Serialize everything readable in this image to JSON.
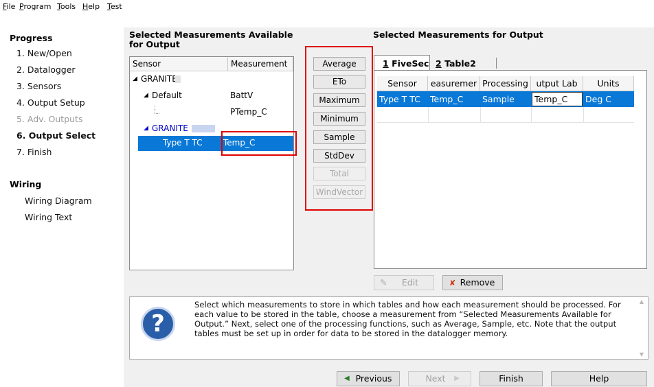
{
  "menu": [
    "File",
    "Program",
    "Tools",
    "Help",
    "Test"
  ],
  "progress": {
    "title": "Progress",
    "steps": [
      "1. New/Open",
      "2. Datalogger",
      "3. Sensors",
      "4. Output Setup",
      "5. Adv. Outputs",
      "6. Output Select",
      "7. Finish"
    ]
  },
  "wiring": {
    "title": "Wiring",
    "items": [
      "Wiring Diagram",
      "Wiring Text"
    ]
  },
  "available": {
    "title": "Selected Measurements Available for Output",
    "columns": [
      "Sensor",
      "Measurement"
    ],
    "rows": [
      {
        "sensor": "GRANITE",
        "measurement": ""
      },
      {
        "sensor": "Default",
        "measurement": "BattV"
      },
      {
        "sensor": "",
        "measurement": "PTemp_C"
      },
      {
        "sensor": "GRANITE",
        "measurement": ""
      },
      {
        "sensor": "Type T TC",
        "measurement": "Temp_C"
      }
    ]
  },
  "functions": [
    "Average",
    "ETo",
    "Maximum",
    "Minimum",
    "Sample",
    "StdDev",
    "Total",
    "WindVector"
  ],
  "output": {
    "title": "Selected Measurements for Output",
    "tabs": [
      {
        "num": "1",
        "name": "FiveSec"
      },
      {
        "num": "2",
        "name": "Table2"
      }
    ],
    "columns": [
      "Sensor",
      "easuremer",
      "Processing",
      "utput Lab",
      "Units"
    ],
    "row": {
      "sensor": "Type T TC",
      "measurement": "Temp_C",
      "processing": "Sample",
      "label": "Temp_C",
      "units": "Deg C"
    },
    "edit_label": "Edit",
    "remove_label": "Remove"
  },
  "help_text": "Select which measurements to store in which tables and how each measurement should be processed. For each value to be stored in the table, choose a measurement from “Selected Measurements Available for Output.” Next, select one of the processing functions, such as Average, Sample, etc. Note that the output tables must be set up in order for data to be stored in the datalogger memory.",
  "nav": {
    "previous": "Previous",
    "next": "Next",
    "finish": "Finish",
    "help": "Help"
  },
  "colors": {
    "selection": "#0a78d7",
    "highlight": "#e00000",
    "link_blue": "#0000cc",
    "help_icon": "#2a5ea8"
  }
}
